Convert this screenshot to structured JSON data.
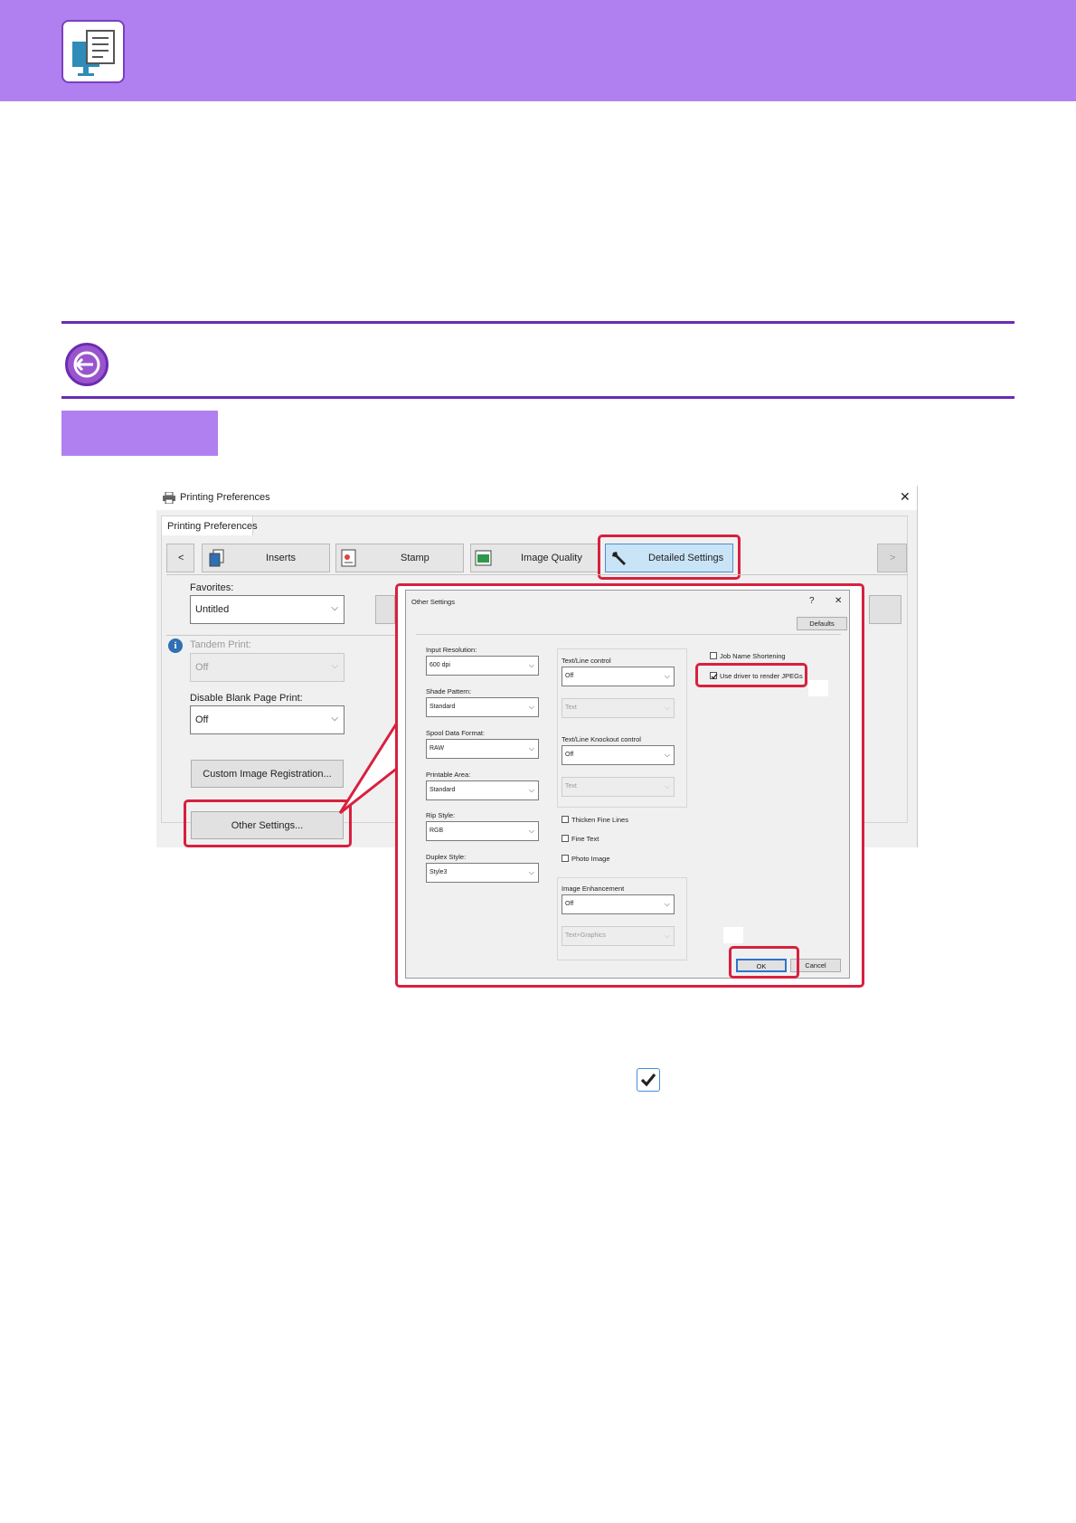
{
  "printing_preferences": {
    "window_title": "Printing Preferences",
    "tab_label": "Printing Preferences",
    "tabs": [
      {
        "label": "<",
        "icon": "chevron-left-icon"
      },
      {
        "label": "Inserts",
        "icon": "inserts-icon"
      },
      {
        "label": "Stamp",
        "icon": "stamp-icon"
      },
      {
        "label": "Image Quality",
        "icon": "image-quality-icon"
      },
      {
        "label": "Detailed Settings",
        "icon": "wrench-icon"
      },
      {
        "label": ">",
        "icon": "chevron-right-icon"
      }
    ],
    "favorites_label": "Favorites:",
    "favorites_value": "Untitled",
    "tandem_label": "Tandem Print:",
    "tandem_value": "Off",
    "disable_blank_label": "Disable Blank Page Print:",
    "disable_blank_value": "Off",
    "custom_image_button": "Custom Image Registration...",
    "other_settings_button": "Other Settings..."
  },
  "other_settings": {
    "title": "Other Settings",
    "help": "?",
    "close": "✕",
    "defaults_button": "Defaults",
    "left_fields": [
      {
        "label": "Input Resolution:",
        "value": "600 dpi"
      },
      {
        "label": "Shade Pattern:",
        "value": "Standard"
      },
      {
        "label": "Spool Data Format:",
        "value": "RAW"
      },
      {
        "label": "Printable Area:",
        "value": "Standard"
      },
      {
        "label": "Rip Style:",
        "value": "RGB"
      },
      {
        "label": "Duplex Style:",
        "value": "Style3"
      }
    ],
    "text_line_control_label": "Text/Line control",
    "text_line_control_value": "Off",
    "text_line_sub_value": "Text",
    "knockout_label": "Text/Line Knockout control",
    "knockout_value": "Off",
    "knockout_sub_value": "Text",
    "thicken_fine_lines": "Thicken Fine Lines",
    "fine_text": "Fine Text",
    "photo_image": "Photo Image",
    "image_enhancement_label": "Image Enhancement",
    "image_enhancement_value": "Off",
    "image_enhancement_sub_value": "Text+Graphics",
    "job_name_shortening": "Job Name Shortening",
    "use_driver_jpegs": "Use driver to render JPEGs",
    "ok_button": "OK",
    "cancel_button": "Cancel"
  },
  "colors": {
    "banner": "#b080f0",
    "rule": "#6a2cb3",
    "highlight": "#d8203e",
    "selected_tab": "#c9e3f7"
  }
}
